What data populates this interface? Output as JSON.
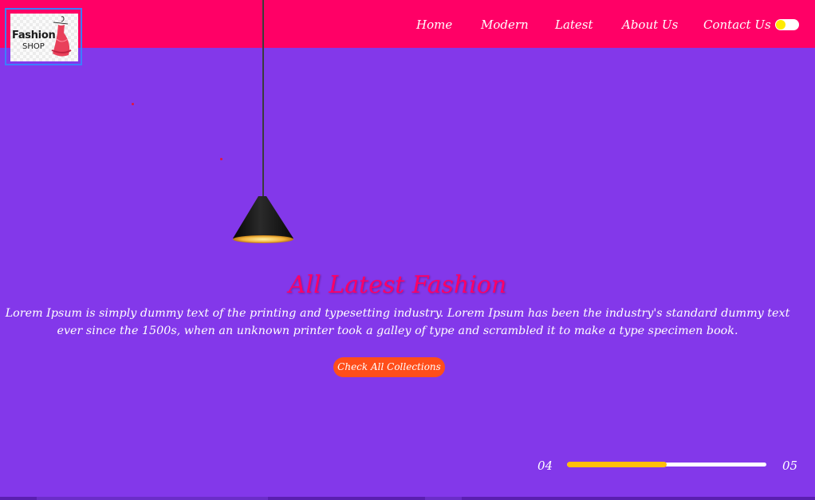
{
  "header": {
    "logo": {
      "line1": "Fashion",
      "line2": "SHOP"
    },
    "nav": [
      {
        "label": "Home"
      },
      {
        "label": "Modern"
      },
      {
        "label": "Latest"
      },
      {
        "label": "About Us"
      },
      {
        "label": "Contact Us"
      }
    ],
    "theme_toggle": {
      "state": "off"
    }
  },
  "hero": {
    "title": "All Latest Fashion",
    "description": "Lorem Ipsum is simply dummy text of the printing and typesetting industry. Lorem Ipsum has been the industry's standard dummy text ever since the 1500s, when an unknown printer took a galley of type and scrambled it to make a type specimen book.",
    "cta_label": "Check All Collections"
  },
  "slider": {
    "current": "04",
    "total": "05",
    "progress": 0.5
  },
  "colors": {
    "background": "#8338ea",
    "header": "#ff0066",
    "title": "#ff0066",
    "cta": "#ff4e1a",
    "progress_fill": "#ffbe0b",
    "toggle_knob": "#ffeb00"
  },
  "icons": [
    "lamp-icon",
    "dress-icon",
    "toggle-switch"
  ]
}
